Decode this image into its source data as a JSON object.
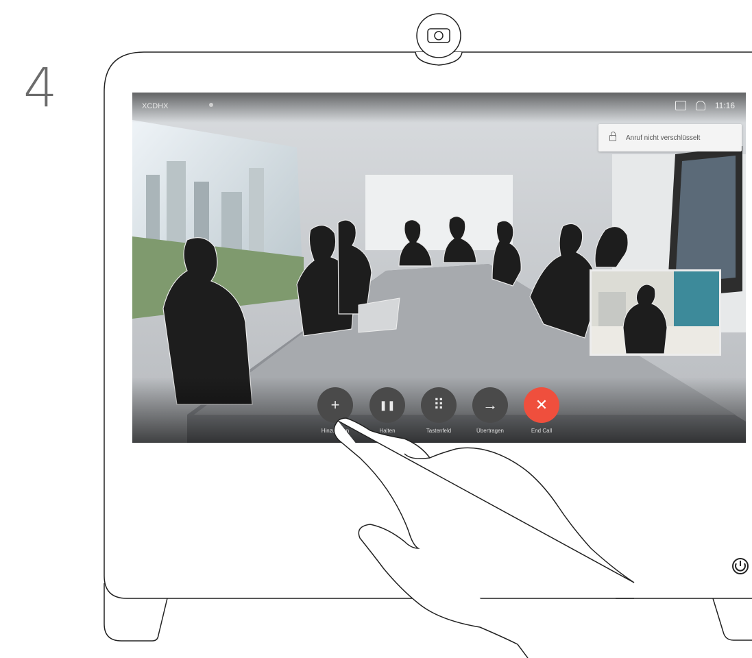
{
  "step": {
    "number": "4"
  },
  "call": {
    "site_name": "XCDHX",
    "time": "11:16",
    "lock_banner": "Anruf nicht verschlüsselt"
  },
  "controls": [
    {
      "label": "Hinzufügen",
      "icon": "plus-icon",
      "glyph": "+"
    },
    {
      "label": "Halten",
      "icon": "pause-icon",
      "glyph": "❚❚"
    },
    {
      "label": "Tastenfeld",
      "icon": "keypad-icon",
      "glyph": "⠿"
    },
    {
      "label": "Übertragen",
      "icon": "transfer-arrow-icon",
      "glyph": "→"
    },
    {
      "label": "End Call",
      "icon": "close-icon",
      "glyph": "✕"
    }
  ],
  "colors": {
    "end_call": "#ef4f3d",
    "control": "#4a4a4a"
  }
}
